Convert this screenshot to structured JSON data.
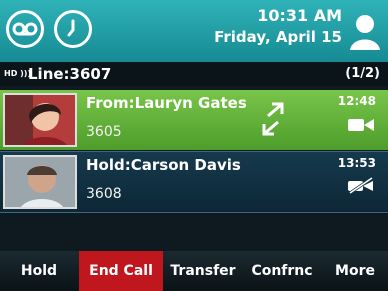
{
  "header": {
    "time": "10:31 AM",
    "date": "Friday, April 15"
  },
  "line": {
    "hd_label": "HD",
    "label": "Line:3607",
    "count": "(1/2)"
  },
  "calls": [
    {
      "title": "From:Lauryn Gates",
      "number": "3605",
      "duration": "12:48"
    },
    {
      "title": "Hold:Carson Davis",
      "number": "3608",
      "duration": "13:53"
    }
  ],
  "softkeys": {
    "hold": "Hold",
    "end_call": "End Call",
    "transfer": "Transfer",
    "conference": "Confrnc",
    "more": "More"
  },
  "colors": {
    "active_call": "#5ea637",
    "held_call": "#12364a",
    "end_call": "#c0161d"
  },
  "icons": [
    "voicemail-icon",
    "clock-icon",
    "user-icon",
    "swap-video-icon",
    "video-camera-icon",
    "video-muted-icon"
  ]
}
